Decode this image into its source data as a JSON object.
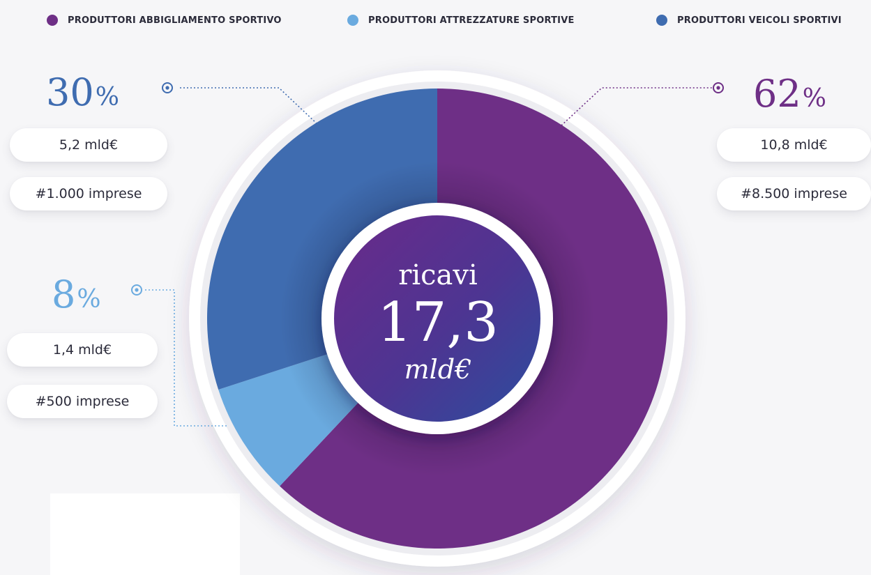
{
  "chart_data": {
    "type": "pie",
    "variant": "donut",
    "legend_position": "top",
    "center": {
      "label": "ricavi",
      "value": "17,3",
      "unit": "mld€"
    },
    "slices": [
      {
        "name": "PRODUTTORI ABBIGLIAMENTO SPORTIVO",
        "percent_value": 62,
        "percent_text": "62",
        "percent_symbol": "%",
        "revenue": "10,8 mld€",
        "companies": "#8.500 imprese",
        "color": "#6e2f86"
      },
      {
        "name": "PRODUTTORI ATTREZZATURE SPORTIVE",
        "percent_value": 8,
        "percent_text": "8",
        "percent_symbol": "%",
        "revenue": "1,4 mld€",
        "companies": "#500 imprese",
        "color": "#6aaadf"
      },
      {
        "name": "PRODUTTORI VEICOLI SPORTIVI",
        "percent_value": 30,
        "percent_text": "30",
        "percent_symbol": "%",
        "revenue": "5,2 mld€",
        "companies": "#1.000 imprese",
        "color": "#3f6cb0"
      }
    ]
  }
}
